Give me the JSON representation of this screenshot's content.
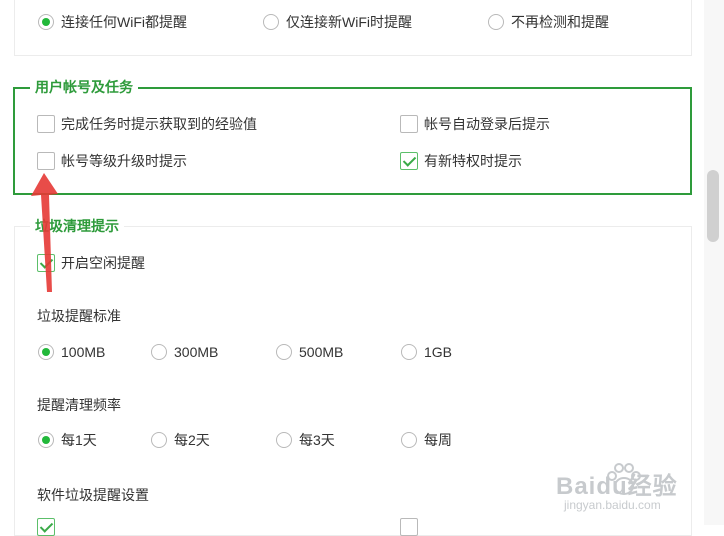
{
  "wifi_reminder": {
    "options": [
      "连接任何WiFi都提醒",
      "仅连接新WiFi时提醒",
      "不再检测和提醒"
    ],
    "selected_index": 0
  },
  "account_tasks": {
    "legend": "用户帐号及任务",
    "items": [
      {
        "label": "完成任务时提示获取到的经验值",
        "checked": false
      },
      {
        "label": "帐号自动登录后提示",
        "checked": false
      },
      {
        "label": "帐号等级升级时提示",
        "checked": false
      },
      {
        "label": "有新特权时提示",
        "checked": true
      }
    ]
  },
  "junk_cleanup": {
    "legend": "垃圾清理提示",
    "idle_reminder": {
      "label": "开启空闲提醒",
      "checked": true
    },
    "threshold": {
      "title": "垃圾提醒标准",
      "options": [
        "100MB",
        "300MB",
        "500MB",
        "1GB"
      ],
      "selected_index": 0
    },
    "frequency": {
      "title": "提醒清理频率",
      "options": [
        "每1天",
        "每2天",
        "每3天",
        "每周"
      ],
      "selected_index": 0
    },
    "software_junk": {
      "title": "软件垃圾提醒设置"
    }
  },
  "watermark": {
    "brand": "Baidu经验",
    "url": "jingyan.baidu.com"
  },
  "colors": {
    "accent": "#22b83a",
    "group_border": "#2e9b3b",
    "annotation_arrow": "#e53935"
  }
}
